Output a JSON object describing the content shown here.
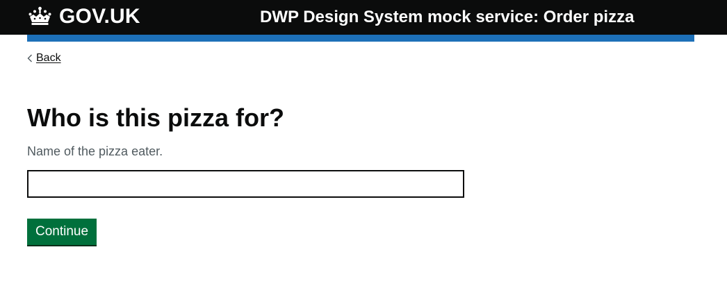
{
  "header": {
    "logo_text": "GOV.UK",
    "logo_icon": "crown-icon",
    "service_name": "DWP Design System mock service: Order pizza",
    "background_color": "#0b0c0c",
    "accent_bar_color": "#1d70b8"
  },
  "navigation": {
    "back_label": "Back",
    "back_icon": "chevron-left-icon"
  },
  "main": {
    "title": "Who is this pizza for?",
    "hint": "Name of the pizza eater.",
    "input": {
      "value": "",
      "placeholder": ""
    },
    "continue_label": "Continue",
    "button_color": "#00703c"
  }
}
